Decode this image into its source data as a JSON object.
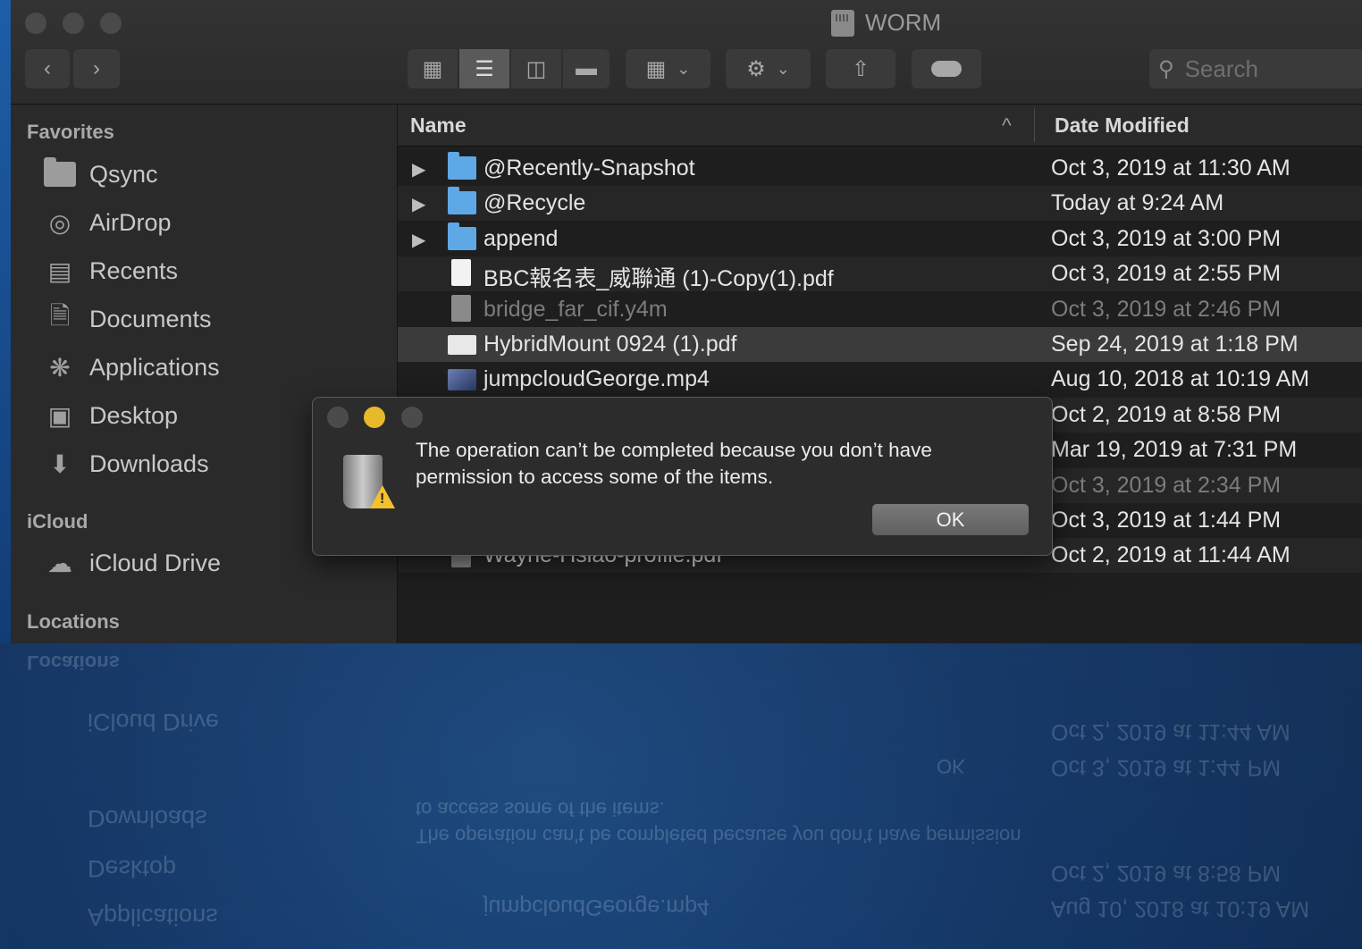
{
  "window": {
    "title": "WORM"
  },
  "toolbar": {
    "back_icon": "chevron-left-icon",
    "forward_icon": "chevron-right-icon",
    "view_icons": [
      "icon-view-icon",
      "list-view-icon",
      "column-view-icon",
      "gallery-view-icon"
    ],
    "group_icon": "group-by-icon",
    "action_icon": "gear-icon",
    "share_icon": "share-icon",
    "tag_icon": "tag-icon",
    "search_placeholder": "Search"
  },
  "sidebar": {
    "favorites_heading": "Favorites",
    "favorites": [
      {
        "label": "Qsync",
        "icon": "folder-icon"
      },
      {
        "label": "AirDrop",
        "icon": "airdrop-icon"
      },
      {
        "label": "Recents",
        "icon": "recents-icon"
      },
      {
        "label": "Documents",
        "icon": "documents-icon"
      },
      {
        "label": "Applications",
        "icon": "applications-icon"
      },
      {
        "label": "Desktop",
        "icon": "desktop-icon"
      },
      {
        "label": "Downloads",
        "icon": "downloads-icon"
      }
    ],
    "icloud_heading": "iCloud",
    "icloud": [
      {
        "label": "iCloud Drive",
        "icon": "cloud-icon"
      }
    ],
    "locations_heading": "Locations"
  },
  "file_list": {
    "columns": {
      "name": "Name",
      "date": "Date Modified",
      "sort_indicator": "^"
    },
    "rows": [
      {
        "name": "@Recently-Snapshot",
        "date": "Oct 3, 2019 at 11:30 AM",
        "type": "folder"
      },
      {
        "name": "@Recycle",
        "date": "Today at 9:24 AM",
        "type": "folder"
      },
      {
        "name": "append",
        "date": "Oct 3, 2019 at 3:00 PM",
        "type": "folder"
      },
      {
        "name": "BBC報名表_威聯通 (1)-Copy(1).pdf",
        "date": "Oct 3, 2019 at 2:55 PM",
        "type": "pdf"
      },
      {
        "name": "bridge_far_cif.y4m",
        "date": "Oct 3, 2019 at 2:46 PM",
        "type": "file"
      },
      {
        "name": "HybridMount 0924 (1).pdf",
        "date": "Sep 24, 2019 at 1:18 PM",
        "type": "pdf"
      },
      {
        "name": "jumpcloudGeorge.mp4",
        "date": "Aug 10, 2018 at 10:19 AM",
        "type": "video"
      },
      {
        "name": "",
        "date": "Oct 2, 2019 at 8:58 PM",
        "type": "file"
      },
      {
        "name": "",
        "date": "Mar 19, 2019 at 7:31 PM",
        "type": "file"
      },
      {
        "name": "",
        "date": "Oct 3, 2019 at 2:34 PM",
        "type": "file"
      },
      {
        "name": "",
        "date": "Oct 3, 2019 at 1:44 PM",
        "type": "file"
      },
      {
        "name": "Wayne-Hsiao-profile.pdf",
        "date": "Oct 2, 2019 at 11:44 AM",
        "type": "pdf"
      }
    ]
  },
  "dialog": {
    "message": "The operation can’t be completed because you don’t have permission to access some of the items.",
    "ok_label": "OK",
    "icon": "trash-warning-icon"
  }
}
